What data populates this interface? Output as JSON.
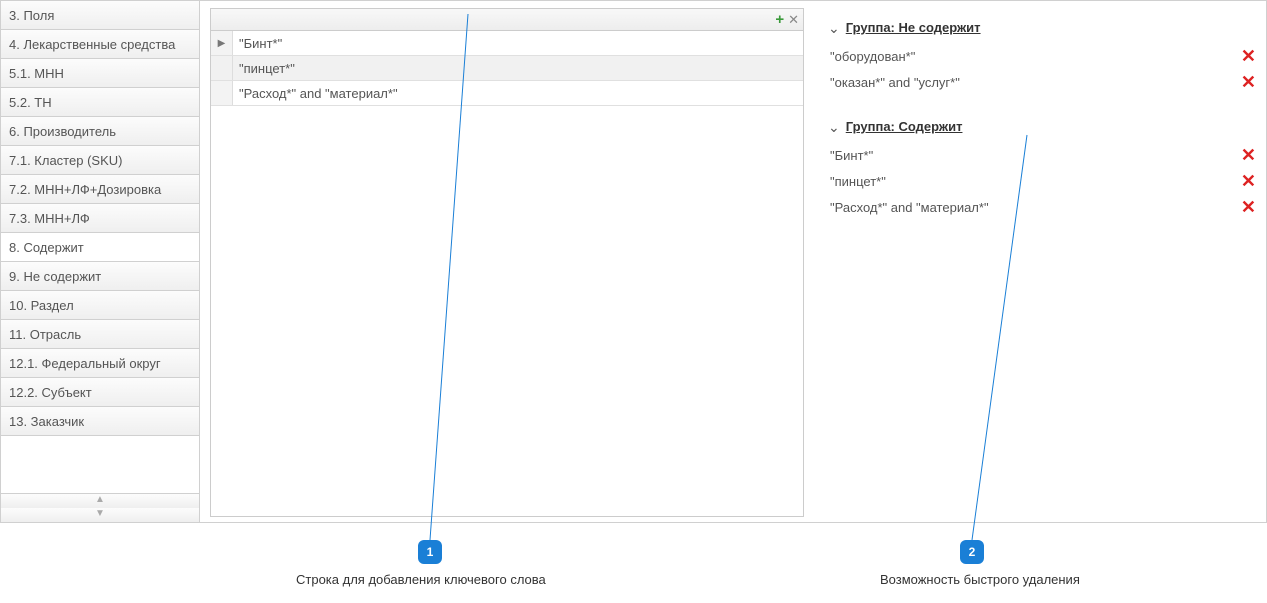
{
  "sidebar": {
    "items": [
      {
        "label": "3. Поля"
      },
      {
        "label": "4. Лекарственные средства"
      },
      {
        "label": "5.1. МНН"
      },
      {
        "label": "5.2. ТН"
      },
      {
        "label": "6. Производитель"
      },
      {
        "label": "7.1. Кластер (SKU)"
      },
      {
        "label": "7.2. МНН+ЛФ+Дозировка"
      },
      {
        "label": "7.3. МНН+ЛФ"
      },
      {
        "label": "8. Содержит"
      },
      {
        "label": "9. Не содержит"
      },
      {
        "label": "10. Раздел"
      },
      {
        "label": "11. Отрасль"
      },
      {
        "label": "12.1. Федеральный округ"
      },
      {
        "label": "12.2. Субъект"
      },
      {
        "label": "13. Заказчик"
      }
    ],
    "active_index": 8
  },
  "keywords": {
    "rows": [
      {
        "text": "\"Бинт*\""
      },
      {
        "text": "\"пинцет*\""
      },
      {
        "text": "\"Расход*\" and \"материал*\""
      }
    ]
  },
  "groups": [
    {
      "title": "Группа: Не содержит",
      "items": [
        {
          "text": "\"оборудован*\""
        },
        {
          "text": "\"оказан*\" and \"услуг*\""
        }
      ]
    },
    {
      "title": "Группа: Содержит",
      "items": [
        {
          "text": "\"Бинт*\""
        },
        {
          "text": "\"пинцет*\""
        },
        {
          "text": "\"Расход*\" and \"материал*\""
        }
      ]
    }
  ],
  "annotations": {
    "a1": {
      "num": "1",
      "text": "Строка для добавления ключевого слова"
    },
    "a2": {
      "num": "2",
      "text": "Возможность быстрого удаления"
    }
  }
}
